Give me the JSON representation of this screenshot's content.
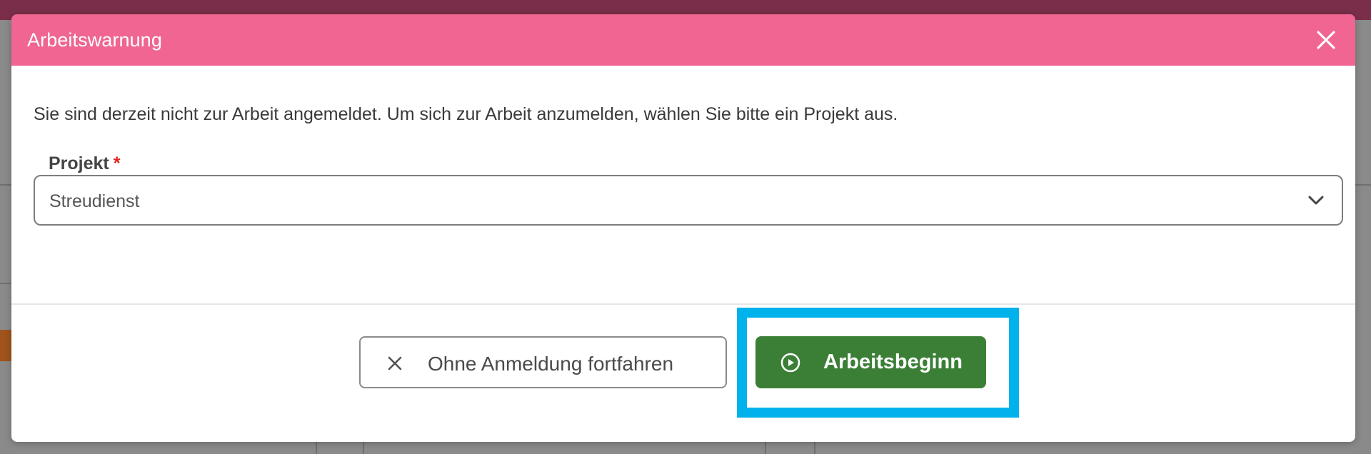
{
  "dialog": {
    "title": "Arbeitswarnung",
    "close_icon": "close-icon",
    "message": "Sie sind derzeit nicht zur Arbeit angemeldet. Um sich zur Arbeit anzumelden, wählen Sie bitte ein Projekt aus.",
    "project_field": {
      "label": "Projekt",
      "required_marker": "*",
      "selected_value": "Streudienst",
      "dropdown_icon": "chevron-down-icon"
    },
    "buttons": {
      "continue_without_login": {
        "label": "Ohne Anmeldung fortfahren",
        "icon": "close-icon"
      },
      "start_work": {
        "label": "Arbeitsbeginn",
        "icon": "play-circle-icon"
      }
    }
  },
  "colors": {
    "header": "#f06591",
    "primary_button": "#3b7f37",
    "highlight": "#00b2ec",
    "background_bar": "#7a2e4a",
    "required": "#e02424"
  }
}
